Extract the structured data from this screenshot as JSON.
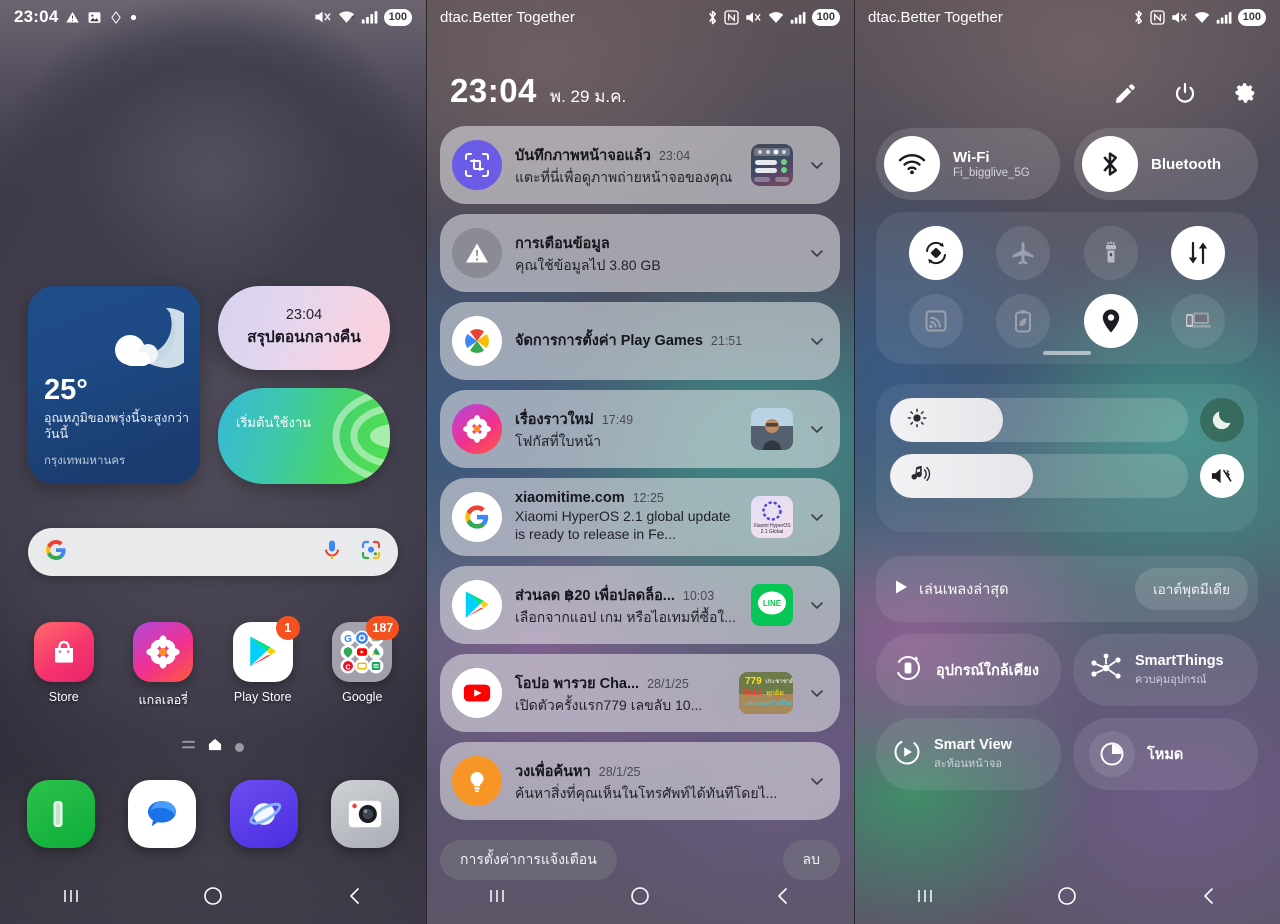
{
  "home": {
    "statusbar": {
      "time": "23:04",
      "icons_left": [
        "warning-triangle-icon",
        "image-icon",
        "diamond-icon",
        "dot-icon"
      ],
      "icons_right": [
        "mute-icon",
        "wifi-icon",
        "signal-icon"
      ],
      "battery": "100"
    },
    "weather_widget": {
      "temperature": "25°",
      "description": "อุณหภูมิของพรุ่งนี้จะสูงกว่าวันนี้",
      "city": "กรุงเทพมหานคร",
      "icon": "moon-cloud-icon"
    },
    "brief_widget": {
      "time": "23:04",
      "title": "สรุปตอนกลางคืน"
    },
    "bittorrent_widget": {
      "label": "เริ่มต้นใช้งาน",
      "icon": "bittorrent-waves-icon"
    },
    "search": {
      "placeholder": "",
      "value": "",
      "logo": "google-g-icon",
      "mic": "microphone-icon",
      "lens": "google-lens-icon"
    },
    "apps": [
      {
        "label": "Store",
        "icon": "galaxy-store-icon",
        "badge": ""
      },
      {
        "label": "แกลเลอรี่",
        "icon": "gallery-flower-icon",
        "badge": ""
      },
      {
        "label": "Play Store",
        "icon": "play-store-icon",
        "badge": "1"
      },
      {
        "label": "Google",
        "icon": "google-folder-icon",
        "badge": "187"
      }
    ],
    "page_indicators": [
      "list-page-icon",
      "home-page-icon",
      "dot-page-icon"
    ],
    "active_page_index": 1,
    "dock": [
      {
        "label": "Phone",
        "icon": "phone-icon"
      },
      {
        "label": "Messages",
        "icon": "messages-icon"
      },
      {
        "label": "Internet",
        "icon": "samsung-internet-icon"
      },
      {
        "label": "Camera",
        "icon": "camera-icon"
      }
    ],
    "navbar": [
      {
        "name": "recents",
        "icon": "recents-icon"
      },
      {
        "name": "home",
        "icon": "home-circle-icon"
      },
      {
        "name": "back",
        "icon": "back-chevron-icon"
      }
    ]
  },
  "shade": {
    "statusbar": {
      "carrier": "dtac.Better Together",
      "icons_right": [
        "bluetooth-icon",
        "nfc-icon",
        "mute-icon",
        "wifi-icon",
        "signal-icon"
      ],
      "battery": "100"
    },
    "clock": {
      "time": "23:04",
      "date": "พ. 29 ม.ค."
    },
    "notifications": [
      {
        "app_icon": "screenshot-capture-icon",
        "title": "บันทึกภาพหน้าจอแล้ว",
        "time": "23:04",
        "text": "แตะที่นี่เพื่อดูภาพถ่ายหน้าจอของคุณ",
        "thumb": "screenshot-thumb"
      },
      {
        "app_icon": "data-warning-icon",
        "title": "การเตือนข้อมูล",
        "time": "",
        "text": "คุณใช้ข้อมูลไป 3.80 GB",
        "thumb": ""
      },
      {
        "app_icon": "play-games-icon",
        "title": "จัดการการตั้งค่า Play Games",
        "time": "21:51",
        "text": "",
        "thumb": ""
      },
      {
        "app_icon": "gallery-flower-icon",
        "title": "เรื่องราวใหม่",
        "time": "17:49",
        "text": "โฟกัสที่ใบหน้า",
        "thumb": "person-photo-thumb"
      },
      {
        "app_icon": "google-g-icon",
        "title": "xiaomitime.com",
        "time": "12:25",
        "text": "Xiaomi HyperOS 2.1 global update is ready to release in Fe...",
        "thumb": "hyperos-thumb"
      },
      {
        "app_icon": "play-store-icon",
        "title": "ส่วนลด ฿20 เพื่อปลดล็อ...",
        "time": "10:03",
        "text": "เลือกจากแอป เกม หรือไอเทมที่ซื้อใ...",
        "thumb": "line-thumb"
      },
      {
        "app_icon": "youtube-icon",
        "title": "โอปอ พารวย Cha...",
        "time": "28/1/25",
        "text": "เปิดตัวครั้งแรก779 เลขลับ 10...",
        "thumb": "lottery-thumb"
      },
      {
        "app_icon": "circle-to-search-icon",
        "title": "วงเพื่อค้นหา",
        "time": "28/1/25",
        "text": "ค้นหาสิ่งที่คุณเห็นในโทรศัพท์ได้ทันทีโดยไ...",
        "thumb": ""
      }
    ],
    "settings_button": "การตั้งค่าการแจ้งเตือน",
    "clear_button": "ลบ",
    "navbar": [
      {
        "name": "recents",
        "icon": "recents-icon"
      },
      {
        "name": "home",
        "icon": "home-circle-icon"
      },
      {
        "name": "back",
        "icon": "back-chevron-icon"
      }
    ]
  },
  "quicksettings": {
    "statusbar": {
      "carrier": "dtac.Better Together",
      "icons_right": [
        "bluetooth-icon",
        "nfc-icon",
        "mute-icon",
        "wifi-icon",
        "signal-icon"
      ],
      "battery": "100"
    },
    "toolbar": [
      {
        "name": "edit",
        "icon": "pencil-icon"
      },
      {
        "name": "power",
        "icon": "power-icon"
      },
      {
        "name": "settings",
        "icon": "gear-icon"
      }
    ],
    "wifi": {
      "title": "Wi-Fi",
      "subtitle": "Fi_bigglive_5G",
      "icon": "wifi-icon",
      "state": "on"
    },
    "bluetooth": {
      "title": "Bluetooth",
      "subtitle": "",
      "icon": "bluetooth-icon",
      "state": "on"
    },
    "tiles": [
      {
        "name": "auto-rotate",
        "icon": "auto-rotate-icon",
        "state": "on"
      },
      {
        "name": "airplane-mode",
        "icon": "airplane-icon",
        "state": "off"
      },
      {
        "name": "flashlight",
        "icon": "flashlight-icon",
        "state": "off"
      },
      {
        "name": "mobile-data",
        "icon": "mobile-data-icon",
        "state": "on"
      },
      {
        "name": "smart-view-cast",
        "icon": "cast-icon",
        "state": "off"
      },
      {
        "name": "power-saving",
        "icon": "battery-leaf-icon",
        "state": "off"
      },
      {
        "name": "location",
        "icon": "location-pin-icon",
        "state": "on"
      },
      {
        "name": "link-to-windows",
        "icon": "link-to-windows-icon",
        "state": "off"
      }
    ],
    "brightness": {
      "icon": "brightness-icon",
      "percent": 38,
      "end_icon": "dark-mode-moon-icon",
      "end_state": "off"
    },
    "volume": {
      "icon": "volume-note-icon",
      "percent": 48,
      "end_icon": "mute-vibrate-icon",
      "end_state": "on"
    },
    "media": {
      "label": "เล่นเพลงล่าสุด",
      "play_icon": "play-icon",
      "output_button": "เอาต์พุตมีเดีย"
    },
    "devices": [
      {
        "title": "อุปกรณ์ใกล้เคียง",
        "subtitle": "",
        "icon": "nearby-devices-icon"
      },
      {
        "title": "SmartThings",
        "subtitle": "ควบคุมอุปกรณ์",
        "icon": "smartthings-icon"
      },
      {
        "title": "Smart View",
        "subtitle": "สะท้อนหน้าจอ",
        "icon": "smart-view-icon"
      },
      {
        "title": "โหมด",
        "subtitle": "",
        "icon": "modes-icon"
      }
    ],
    "navbar": [
      {
        "name": "recents",
        "icon": "recents-icon"
      },
      {
        "name": "home",
        "icon": "home-circle-icon"
      },
      {
        "name": "back",
        "icon": "back-chevron-icon"
      }
    ]
  }
}
